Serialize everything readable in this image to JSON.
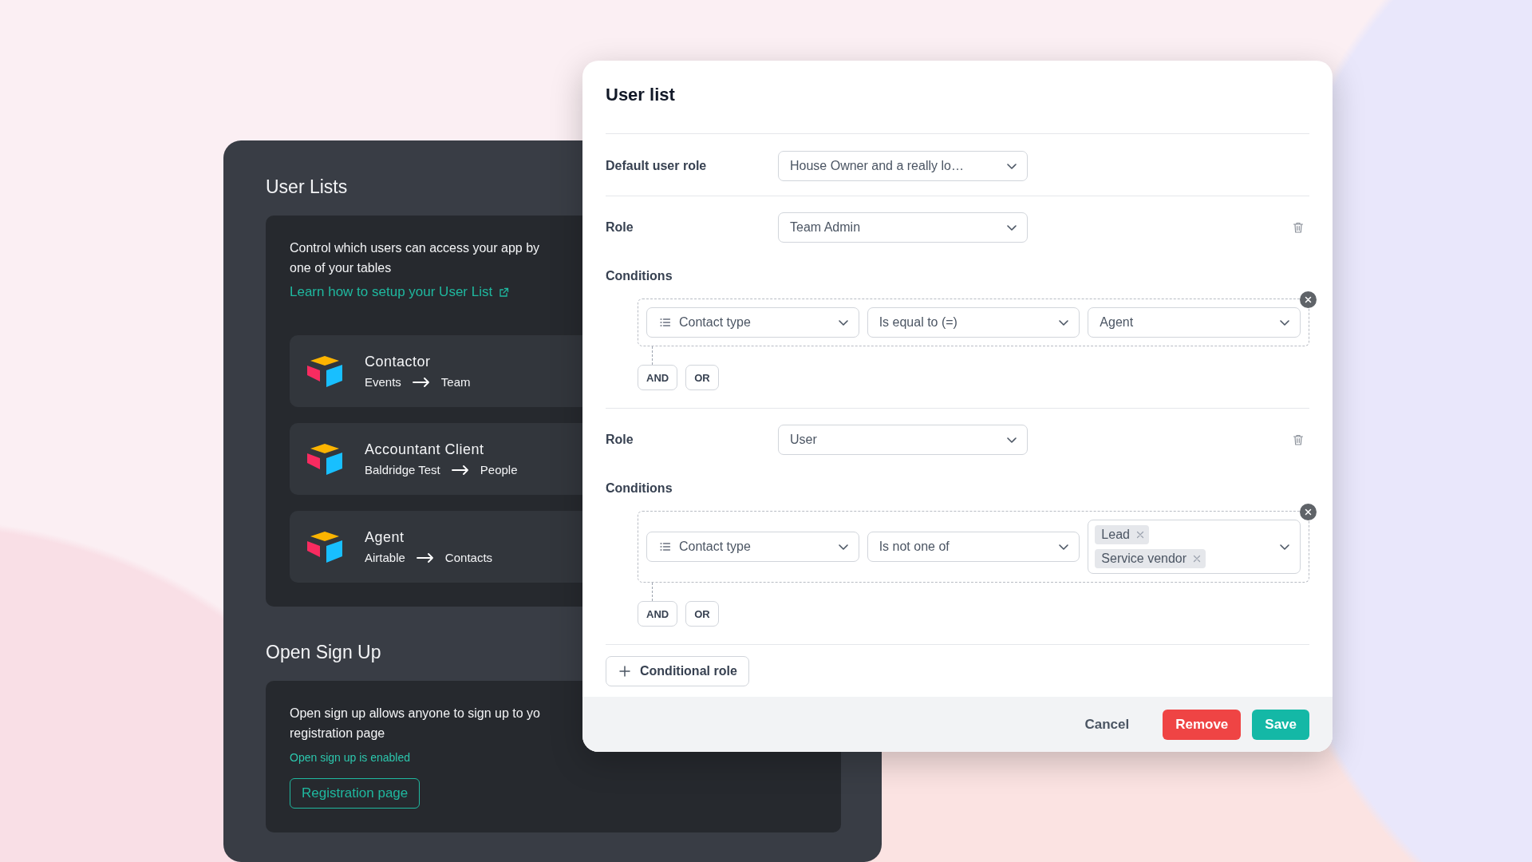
{
  "user_lists": {
    "title": "User Lists",
    "description": "Control which users can access your app by\none of your tables",
    "link": "Learn how to setup your User List",
    "items": [
      {
        "name": "Contactor",
        "source": "Events",
        "target": "Team"
      },
      {
        "name": "Accountant Client",
        "source": "Baldridge Test",
        "target": "People"
      },
      {
        "name": "Agent",
        "source": "Airtable",
        "target": "Contacts"
      }
    ]
  },
  "open_sign_up": {
    "title": "Open Sign Up",
    "description": "Open sign up allows anyone to sign up to yo\nregistration page",
    "status": "Open sign up is enabled",
    "button": "Registration page"
  },
  "dialog": {
    "title": "User list",
    "default_role": {
      "label": "Default user role",
      "value": "House Owner and a really lo…"
    },
    "roles": [
      {
        "label": "Role",
        "value": "Team Admin",
        "conditions_label": "Conditions",
        "and": "AND",
        "or": "OR",
        "conditions": [
          {
            "field": "Contact type",
            "operator": "Is equal to (=)",
            "kind": "single",
            "value": "Agent"
          }
        ]
      },
      {
        "label": "Role",
        "value": "User",
        "conditions_label": "Conditions",
        "and": "AND",
        "or": "OR",
        "conditions": [
          {
            "field": "Contact type",
            "operator": "Is not one of",
            "kind": "multi",
            "values": [
              "Lead",
              "Service vendor"
            ]
          }
        ]
      }
    ],
    "add_button": "Conditional role",
    "footer": {
      "cancel": "Cancel",
      "remove": "Remove",
      "save": "Save"
    }
  }
}
